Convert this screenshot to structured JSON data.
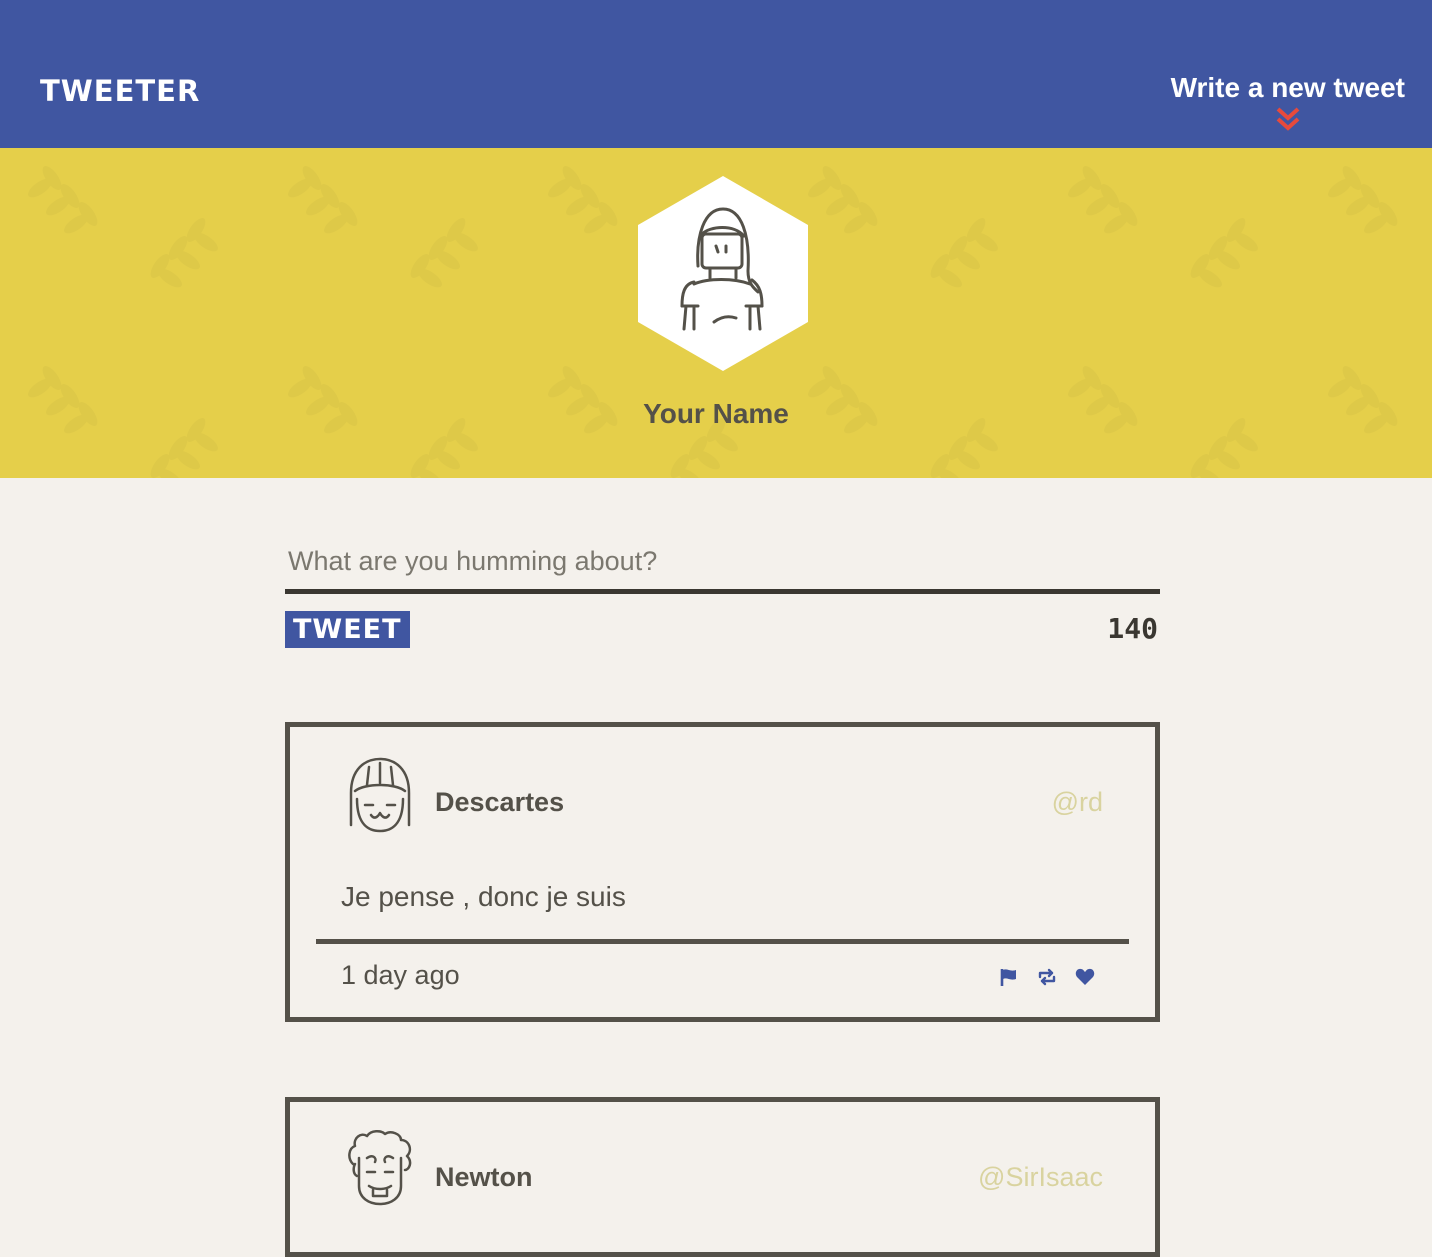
{
  "nav": {
    "brand": "TWEETER",
    "compose_link": "Write a new tweet",
    "colors": {
      "bar": "#4056a1",
      "arrow": "#e64a3c"
    }
  },
  "profile": {
    "name": "Your Name",
    "banner_color": "#e5cf4a"
  },
  "composer": {
    "placeholder": "What are you humming about?",
    "value": "",
    "button_label": "TWEET",
    "char_count": "140"
  },
  "tweets": [
    {
      "author": "Descartes",
      "handle": "@rd",
      "content": "Je pense , donc je suis",
      "timestamp": "1 day ago",
      "actions": [
        "flag-icon",
        "retweet-icon",
        "heart-icon"
      ]
    },
    {
      "author": "Newton",
      "handle": "@SirIsaac"
    }
  ]
}
